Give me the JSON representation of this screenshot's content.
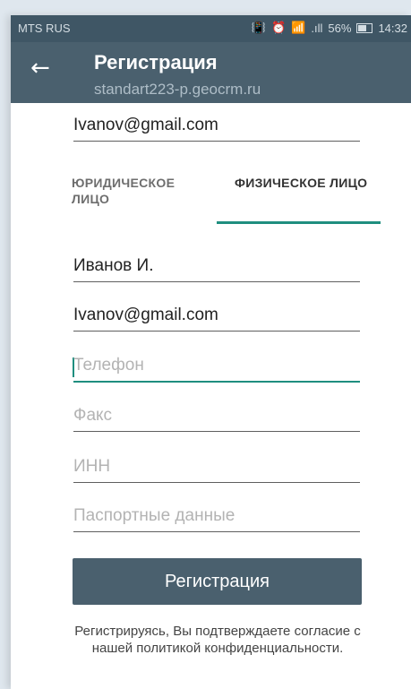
{
  "status_bar": {
    "carrier": "MTS RUS",
    "icons": [
      "vibrate-icon",
      "alarm-icon",
      "wifi-icon",
      "signal-icon",
      "battery-icon"
    ],
    "battery": "56%",
    "time": "14:32"
  },
  "app_bar": {
    "title": "Регистрация",
    "subtitle": "standart223-p.geocrm.ru"
  },
  "form": {
    "top_email": "Ivanov@gmail.com",
    "tabs": [
      {
        "label": "ЮРИДИЧЕСКОЕ ЛИЦО",
        "selected": false
      },
      {
        "label": "ФИЗИЧЕСКОЕ ЛИЦО",
        "selected": true
      }
    ],
    "fields": {
      "name": "Иванов И.",
      "email": "Ivanov@gmail.com",
      "phone_placeholder": "Телефон",
      "fax_placeholder": "Факс",
      "inn_placeholder": "ИНН",
      "passport_placeholder": "Паспортные данные"
    },
    "register_button": "Регистрация",
    "policy_text": "Регистрируясь, Вы подтверждаете согласие с нашей политикой конфиденциальности."
  },
  "colors": {
    "toolbar": "#4a606e",
    "statusbar": "#3f5665",
    "accent": "#1f8e7f"
  }
}
